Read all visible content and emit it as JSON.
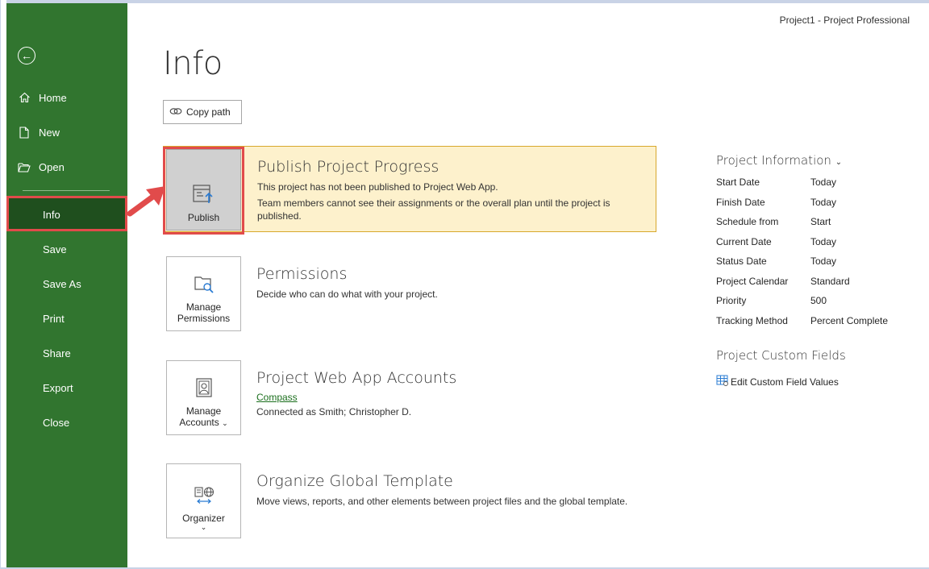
{
  "window_title": "Project1  -  Project Professional",
  "sidebar": {
    "items": [
      {
        "label": "Home",
        "icon": "home-icon"
      },
      {
        "label": "New",
        "icon": "new-document-icon"
      },
      {
        "label": "Open",
        "icon": "folder-open-icon"
      },
      {
        "label": "Info"
      },
      {
        "label": "Save"
      },
      {
        "label": "Save As"
      },
      {
        "label": "Print"
      },
      {
        "label": "Share"
      },
      {
        "label": "Export"
      },
      {
        "label": "Close"
      }
    ]
  },
  "page": {
    "title": "Info",
    "copy_path_label": "Copy path"
  },
  "sections": {
    "publish": {
      "tile_label": "Publish",
      "title": "Publish Project Progress",
      "desc1": "This project has not been published to Project Web App.",
      "desc2": "Team members cannot see their assignments or the overall plan until the project is published."
    },
    "permissions": {
      "tile_label_1": "Manage",
      "tile_label_2": "Permissions",
      "title": "Permissions",
      "desc": "Decide who can do what with your project."
    },
    "accounts": {
      "tile_label_1": "Manage",
      "tile_label_2": "Accounts",
      "title": "Project Web App Accounts",
      "link": "Compass",
      "desc": "Connected as Smith; Christopher D."
    },
    "organizer": {
      "tile_label": "Organizer",
      "title": "Organize Global Template",
      "desc": "Move views, reports, and other elements between project files and the global template."
    }
  },
  "project_information": {
    "heading": "Project Information",
    "rows": [
      {
        "key": "Start Date",
        "value": "Today"
      },
      {
        "key": "Finish Date",
        "value": "Today"
      },
      {
        "key": "Schedule from",
        "value": "Start"
      },
      {
        "key": "Current Date",
        "value": "Today"
      },
      {
        "key": "Status Date",
        "value": "Today"
      },
      {
        "key": "Project Calendar",
        "value": "Standard"
      },
      {
        "key": "Priority",
        "value": "500"
      },
      {
        "key": "Tracking Method",
        "value": "Percent Complete"
      }
    ]
  },
  "custom_fields": {
    "heading": "Project Custom Fields",
    "edit_label": "Edit Custom Field Values"
  },
  "colors": {
    "sidebar_bg": "#31752f",
    "sidebar_selected": "#1f4f1e",
    "publish_bg": "#fdf1cc",
    "highlight_red": "#e14b4b",
    "link_green": "#1b6f1d"
  }
}
